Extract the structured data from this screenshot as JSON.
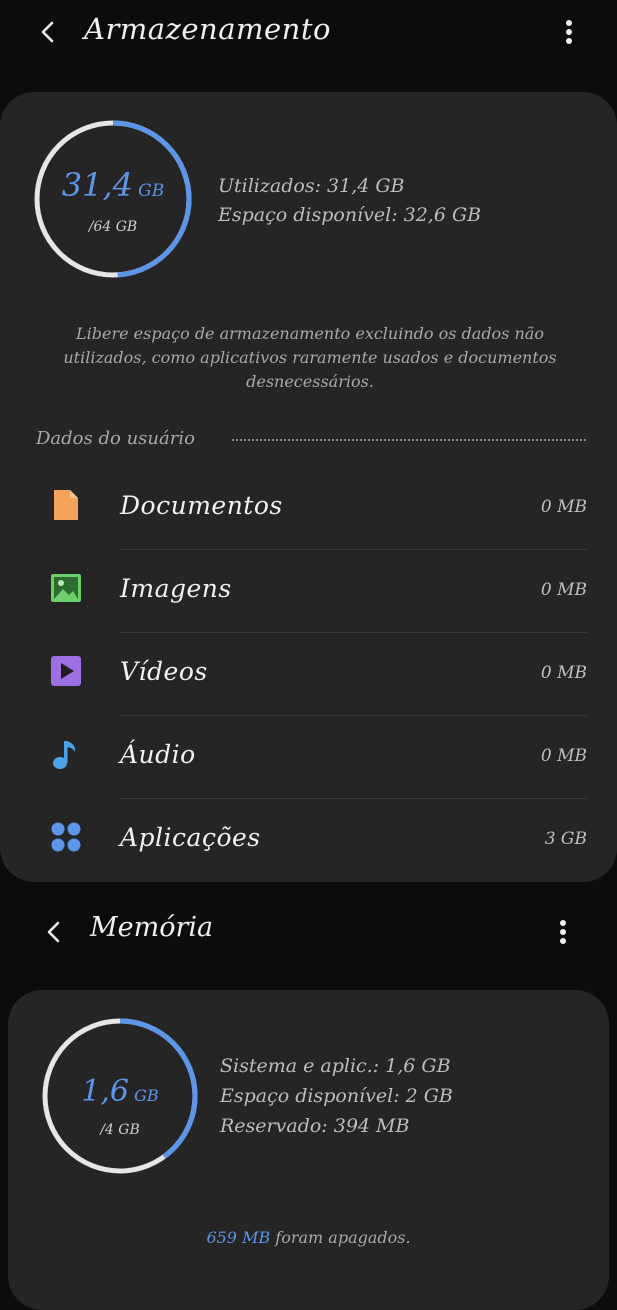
{
  "storage": {
    "title": "Armazenamento",
    "ring": {
      "used": "31,4",
      "used_unit": "GB",
      "total": "/64 GB",
      "fraction": 0.49
    },
    "used_line": "Utilizados: 31,4 GB",
    "free_line": "Espaço disponível: 32,6 GB",
    "hint": "Libere espaço de armazenamento excluindo os dados não utilizados, como aplicativos raramente usados e documentos desnecessários.",
    "section_title": "Dados do usuário",
    "items": [
      {
        "label": "Documentos",
        "value": "0 MB",
        "icon": "document-icon",
        "color": "#f4a35b"
      },
      {
        "label": "Imagens",
        "value": "0 MB",
        "icon": "image-icon",
        "color": "#6ccf6c"
      },
      {
        "label": "Vídeos",
        "value": "0 MB",
        "icon": "video-icon",
        "color": "#9c6fe3"
      },
      {
        "label": "Áudio",
        "value": "0 MB",
        "icon": "audio-icon",
        "color": "#4aa3e8"
      },
      {
        "label": "Aplicações",
        "value": "3 GB",
        "icon": "apps-icon",
        "color": "#5d95e8"
      }
    ]
  },
  "memory": {
    "title": "Memória",
    "ring": {
      "used": "1,6",
      "used_unit": "GB",
      "total": "/4 GB",
      "fraction": 0.4
    },
    "system_line": "Sistema e aplic.: 1,6 GB",
    "free_line": "Espaço disponível: 2 GB",
    "reserved_line": "Reservado: 394 MB",
    "footer_highlight": "659 MB",
    "footer_rest": " foram apagados."
  },
  "colors": {
    "accent": "#5d95e8",
    "ring_track": "#e6e6e6"
  }
}
